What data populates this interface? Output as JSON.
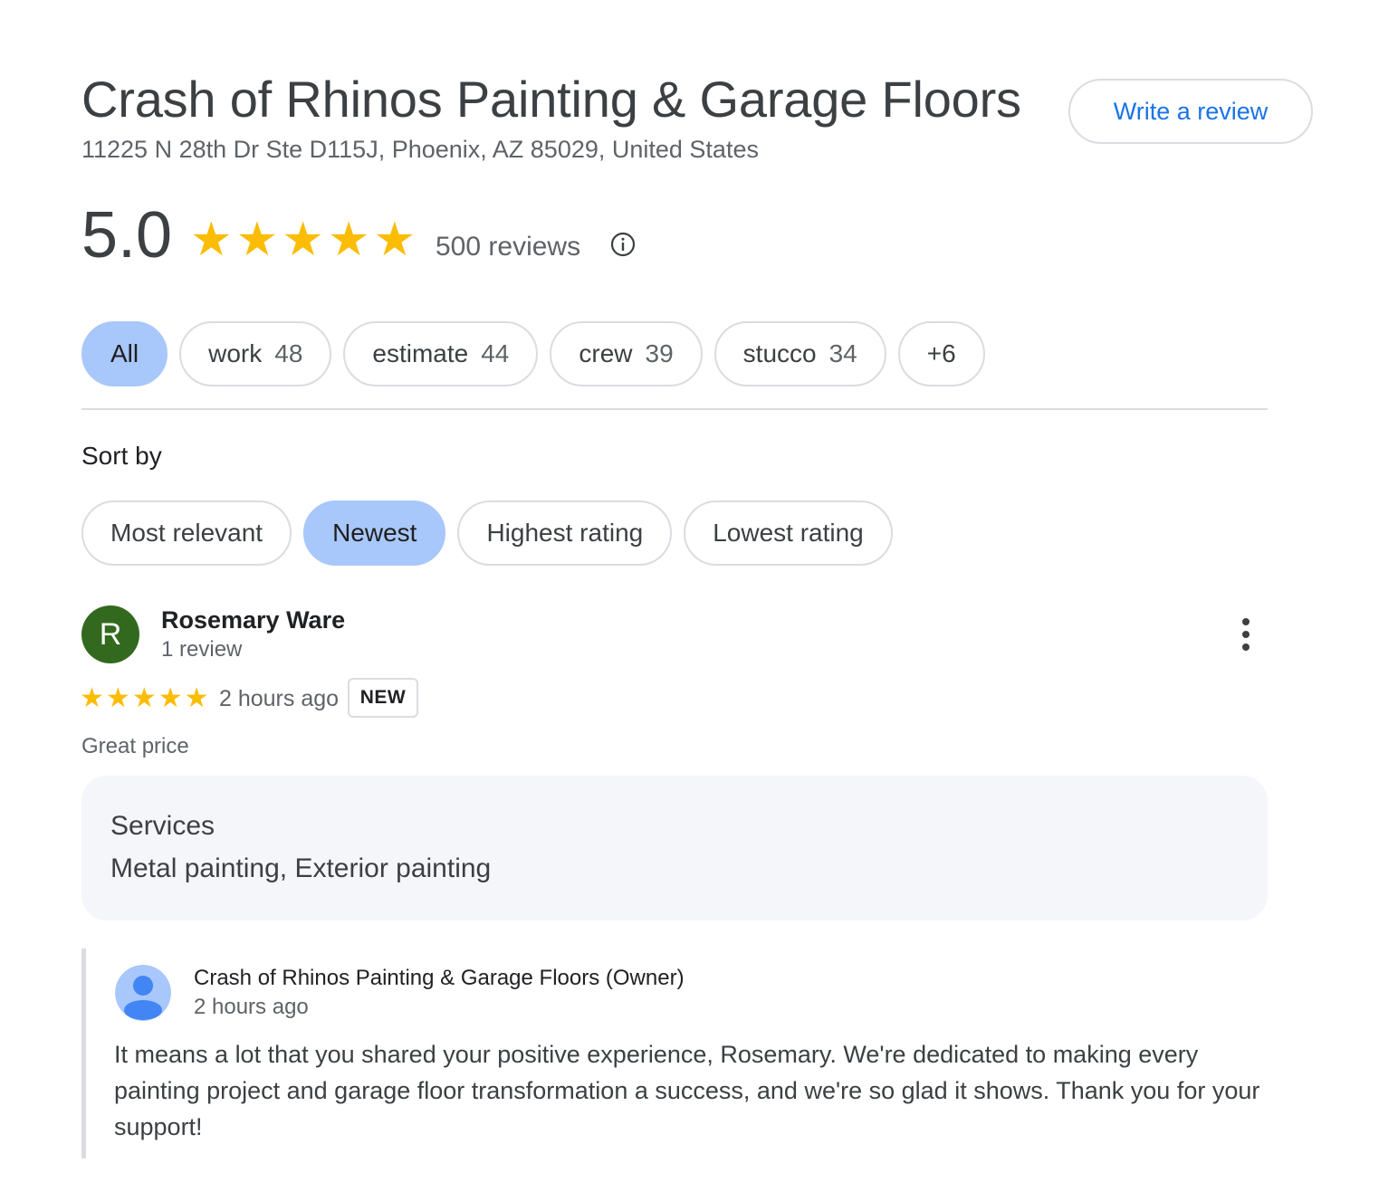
{
  "business": {
    "name": "Crash of Rhinos Painting & Garage Floors",
    "address": "11225 N 28th Dr Ste D115J, Phoenix, AZ 85029, United States",
    "write_review_label": "Write a review"
  },
  "summary": {
    "rating": "5.0",
    "star_count": 5,
    "review_count": "500 reviews",
    "icon": "info-icon"
  },
  "topic_chips": [
    {
      "label": "All",
      "count": "",
      "active": true
    },
    {
      "label": "work",
      "count": "48",
      "active": false
    },
    {
      "label": "estimate",
      "count": "44",
      "active": false
    },
    {
      "label": "crew",
      "count": "39",
      "active": false
    },
    {
      "label": "stucco",
      "count": "34",
      "active": false
    },
    {
      "label": "+6",
      "count": "",
      "active": false
    }
  ],
  "sort": {
    "label": "Sort by",
    "options": [
      {
        "label": "Most relevant",
        "active": false
      },
      {
        "label": "Newest",
        "active": true
      },
      {
        "label": "Highest rating",
        "active": false
      },
      {
        "label": "Lowest rating",
        "active": false
      }
    ]
  },
  "review": {
    "avatar_letter": "R",
    "avatar_color": "#33691e",
    "reviewer_name": "Rosemary Ware",
    "reviewer_meta": "1 review",
    "stars": 5,
    "time": "2 hours ago",
    "badge": "NEW",
    "text": "Great price",
    "services_label": "Services",
    "services_value": "Metal painting, Exterior painting",
    "more_icon": "more-vert-icon"
  },
  "owner_reply": {
    "name": "Crash of Rhinos Painting & Garage Floors (Owner)",
    "time": "2 hours ago",
    "text": "It means a lot that you shared your positive experience, Rosemary. We're dedicated to making every painting project and garage floor transformation a success, and we're so glad it shows. Thank you for your support!",
    "avatar_icon": "person-icon"
  },
  "colors": {
    "accent": "#1a73e8",
    "star": "#fbbc04",
    "active_chip": "#a8c7fa"
  }
}
